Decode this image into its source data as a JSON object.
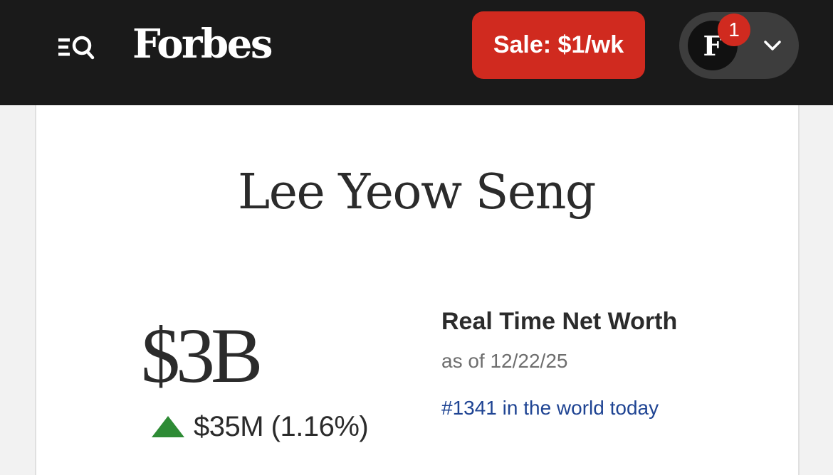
{
  "header": {
    "logo": "Forbes",
    "sale_button": "Sale: $1/wk",
    "account": {
      "avatar_letter": "F",
      "notification_count": "1"
    },
    "icons": {
      "menu_search": "menu-search-icon",
      "dropdown": "chevron-down-icon"
    }
  },
  "profile": {
    "name": "Lee Yeow Seng",
    "net_worth": "$3B",
    "change": "$35M (1.16%)",
    "change_direction": "up",
    "real_time_label": "Real Time Net Worth",
    "as_of": "as of 12/22/25",
    "rank": "#1341 in the world today"
  },
  "colors": {
    "header_bg": "#1a1a1a",
    "sale_red": "#d02a1f",
    "up_green": "#2e8b35",
    "rank_link_blue": "#1f4493"
  }
}
